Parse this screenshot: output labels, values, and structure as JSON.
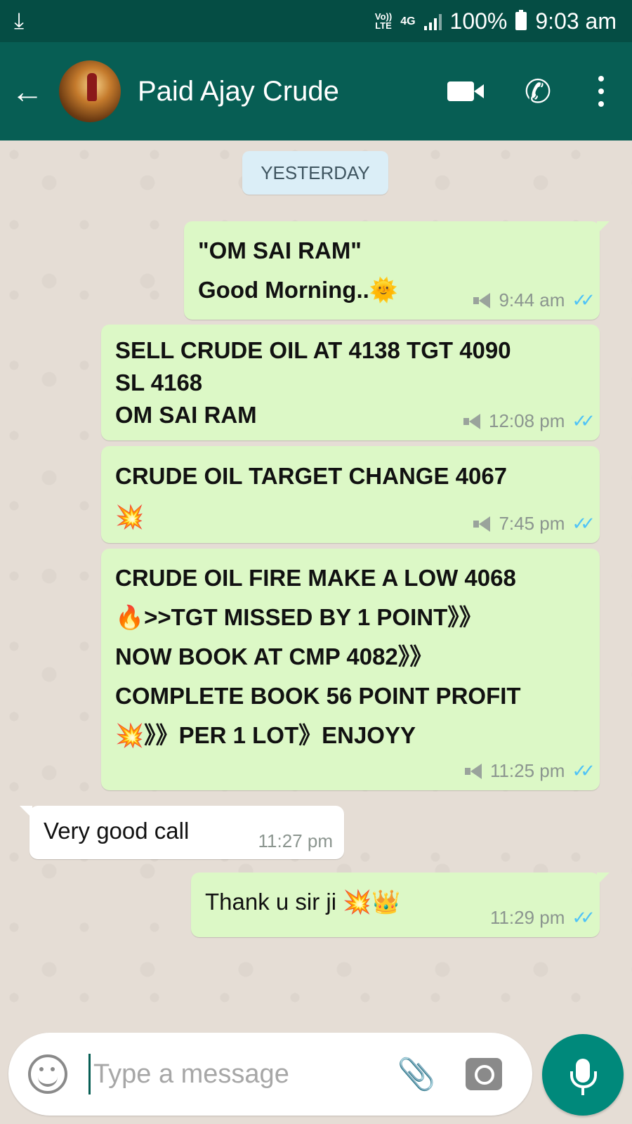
{
  "status_bar": {
    "download_icon": "download-icon",
    "volte": "Vo))\nLTE",
    "network": "4G",
    "battery_percent": "100%",
    "time": "9:03 am"
  },
  "header": {
    "back_icon": "arrow-left-icon",
    "contact_name": "Paid Ajay Crude",
    "video_icon": "video-call-icon",
    "phone_icon": "phone-icon",
    "menu_icon": "more-vert-icon"
  },
  "chat": {
    "date_chip": "YESTERDAY",
    "messages": [
      {
        "direction": "out",
        "text": "\"OM SAI RAM\"\nGood Morning..🌞",
        "time": "9:44 am",
        "broadcast": true,
        "ticks": "✓✓"
      },
      {
        "direction": "out",
        "text": "SELL CRUDE OIL AT 4138 TGT 4090\nSL 4168\nOM SAI RAM",
        "time": "12:08 pm",
        "broadcast": true,
        "ticks": "✓✓"
      },
      {
        "direction": "out",
        "text": "CRUDE OIL TARGET CHANGE 4067\n💥",
        "time": "7:45 pm",
        "broadcast": true,
        "ticks": "✓✓"
      },
      {
        "direction": "out",
        "text": "CRUDE OIL FIRE MAKE A LOW 4068\n🔥>>TGT MISSED BY 1 POINT》》\nNOW BOOK AT CMP 4082》》\nCOMPLETE BOOK 56 POINT PROFIT\n💥》》PER 1 LOT》ENJOYY",
        "time": "11:25 pm",
        "broadcast": true,
        "ticks": "✓✓"
      },
      {
        "direction": "in",
        "text": "Very good call",
        "time": "11:27 pm"
      },
      {
        "direction": "out",
        "text": "Thank u sir ji 💥👑",
        "time": "11:29 pm",
        "ticks": "✓✓"
      }
    ]
  },
  "composer": {
    "emoji_icon": "emoji-icon",
    "placeholder": "Type a message",
    "attach_icon": "paperclip-icon",
    "camera_icon": "camera-icon",
    "mic_icon": "microphone-icon"
  },
  "colors": {
    "status_bar": "#054d44",
    "header": "#075e54",
    "chat_bg": "#e5ddd5",
    "outgoing_bubble": "#dcf8c6",
    "incoming_bubble": "#ffffff",
    "read_ticks": "#4fc3f7",
    "mic_button": "#00897b"
  }
}
